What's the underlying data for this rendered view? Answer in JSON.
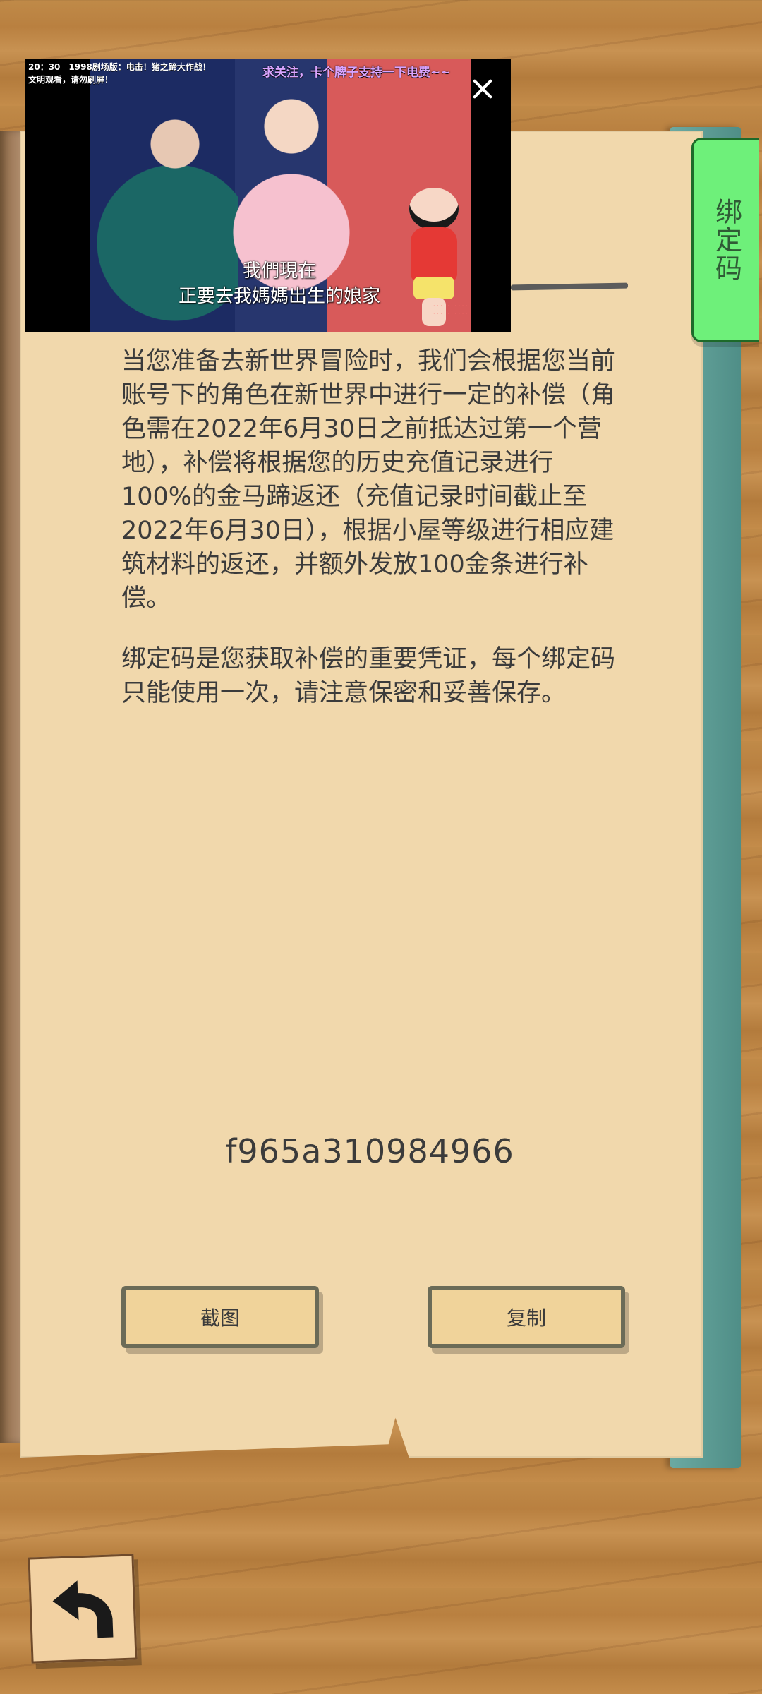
{
  "video": {
    "top_left_text": "20：30　1998剧场版：电击！猪之蹄大作战！\n文明观看，请勿刷屏！",
    "top_right_text": "求关注，卡个牌子支持一下电费~~",
    "subtitle_line1": "我們現在",
    "subtitle_line2": "正要去我媽媽出生的娘家"
  },
  "tab": {
    "label": "绑定码"
  },
  "content": {
    "paragraph1": "当您准备去新世界冒险时，我们会根据您当前账号下的角色在新世界中进行一定的补偿（角色需在2022年6月30日之前抵达过第一个营地），补偿将根据您的历史充值记录进行100%的金马蹄返还（充值记录时间截止至2022年6月30日），根据小屋等级进行相应建筑材料的返还，并额外发放100金条进行补偿。",
    "paragraph2": "绑定码是您获取补偿的重要凭证，每个绑定码只能使用一次，请注意保密和妥善保存。"
  },
  "code": {
    "value": "f965a310984966"
  },
  "buttons": {
    "screenshot": "截图",
    "copy": "复制"
  },
  "icons": {
    "close": "close-icon",
    "back": "back-arrow-icon"
  }
}
